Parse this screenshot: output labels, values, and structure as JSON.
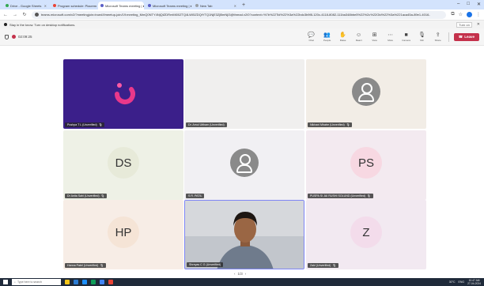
{
  "browser": {
    "tabs": [
      {
        "title": "Drive - Google Sheets",
        "color": "#34a853",
        "active": false
      },
      {
        "title": "Program schedule: Placement",
        "color": "#ea4335",
        "active": false
      },
      {
        "title": "Microsoft Teams meeting | ●",
        "color": "#5b5fc7",
        "active": true
      },
      {
        "title": "Microsoft Teams meeting | ●",
        "color": "#5b5fc7",
        "active": false
      },
      {
        "title": "New Tab",
        "color": "#9aa0a6",
        "active": false
      }
    ],
    "new_tab_label": "+",
    "url": "teams.microsoft.com/v2/?meetingjoin=true#/l/meetup-join/19:meeting_MmQ0NTY4NjQtZDRmMi00ZTQ4LWI5ZDQtYTQ1NjE3ZjBmNjI3@thread.v2/0?context=%7b%22Tid%22%3a%22bdc3b9f8-120c-4118-8082-111ba348bbe5%22%2c%22Oid%22%3a%221aca45a-89e1-4016-",
    "notification": "Stay in the know. Turn on desktop notifications.",
    "notification_action": "Turn on"
  },
  "meeting": {
    "timer": "02:09:25",
    "tools": [
      {
        "icon": "chat-icon",
        "glyph": "💬",
        "label": "Chat"
      },
      {
        "icon": "people-icon",
        "glyph": "👥",
        "label": "People"
      },
      {
        "icon": "raise-hand-icon",
        "glyph": "✋",
        "label": "Raise"
      },
      {
        "icon": "react-icon",
        "glyph": "☺",
        "label": "React"
      },
      {
        "icon": "view-icon",
        "glyph": "⊞",
        "label": "View"
      },
      {
        "icon": "more-icon",
        "glyph": "⋯",
        "label": "More"
      },
      {
        "icon": "camera-icon",
        "glyph": "■",
        "label": "Camera"
      },
      {
        "icon": "mic-icon",
        "glyph": "🎙",
        "label": "Mic"
      },
      {
        "icon": "share-icon",
        "glyph": "⇪",
        "label": "Share"
      }
    ],
    "leave_label": "Leave",
    "participants": [
      {
        "name": "Pushpa T L (Unverified)",
        "type": "logo",
        "bg": "#3b1f8a",
        "muted": true
      },
      {
        "name": "Dr. Amol Uttham (Unverified)",
        "type": "blank",
        "bg": "#f0efee",
        "muted": false
      },
      {
        "name": "Nikhani Mhatre (Unverified)",
        "type": "icon",
        "bg": "#f2ede6",
        "muted": true
      },
      {
        "name": "Dr Anita Sahi (Unverified)",
        "type": "initials",
        "initials": "DS",
        "bg": "#eef1e6",
        "circle": "#e7ead9",
        "muted": true
      },
      {
        "name": "S R. PATIL",
        "type": "icon",
        "bg": "#f1f0f3",
        "muted": false
      },
      {
        "name": "PUSPA SI JAI RUSHI SOLUND (Unverified)",
        "type": "initials",
        "initials": "PS",
        "bg": "#f3eaf0",
        "circle": "#f7d8e2",
        "muted": true
      },
      {
        "name": "Hanna Patel (Unverified)",
        "type": "initials",
        "initials": "HP",
        "bg": "#f7ede6",
        "circle": "#f5e4d6",
        "muted": true
      },
      {
        "name": "Shreyas C G (Unverified)",
        "type": "video",
        "bg": "#c9ccd2",
        "muted": false
      },
      {
        "name": "Zaki (Unverified)",
        "type": "initials",
        "initials": "Z",
        "bg": "#f2e9f1",
        "circle": "#f3dceb",
        "muted": true
      }
    ],
    "pager": {
      "prev": "‹",
      "label": "1/3",
      "next": "›"
    }
  },
  "taskbar": {
    "search_placeholder": "Type here to search",
    "apps": [
      "#f5c518",
      "#2b7cd3",
      "#1e90ff",
      "#0f9d58",
      "#4285f4",
      "#e94335"
    ],
    "weather": "30°C",
    "language": "ENG",
    "time": "10:47 AM",
    "date": "27-04-2024"
  }
}
